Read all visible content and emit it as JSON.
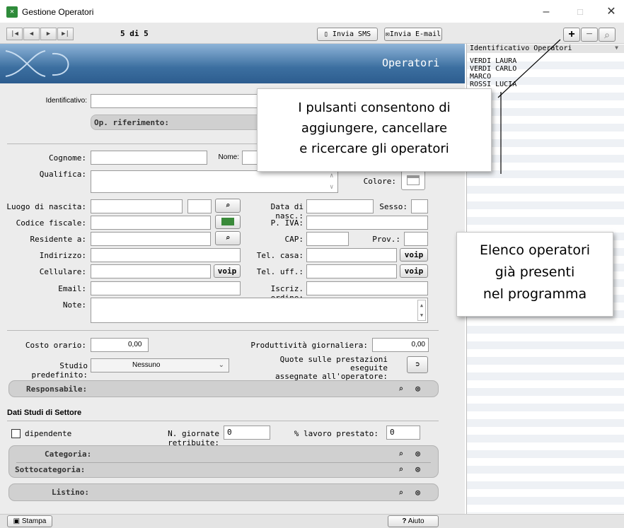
{
  "window": {
    "title": "Gestione Operatori",
    "minimize": "–",
    "maximize": "□",
    "close": "✕"
  },
  "toolbar": {
    "nav": [
      "|◀",
      "◀",
      "▶",
      "▶|"
    ],
    "record_counter": "5 di 5",
    "sms_label": "Invia SMS",
    "email_label": "Invia E-mail",
    "add": "+",
    "remove": "−",
    "search": "⌕"
  },
  "header": {
    "title": "Operatori"
  },
  "form": {
    "identificativo_label": "Identificativo:",
    "identificativo_value": "",
    "op_riferimento_label": "Op. riferimento:",
    "cognome_label": "Cognome:",
    "nome_label": "Nome:",
    "qualifica_label": "Qualifica:",
    "colore_label": "Colore:",
    "luogo_label": "Luogo di nascita:",
    "data_nasc_label": "Data di nasc.:",
    "sesso_label": "Sesso:",
    "codice_fiscale_label": "Codice fiscale:",
    "piva_label": "P. IVA:",
    "residente_label": "Residente a:",
    "cap_label": "CAP:",
    "prov_label": "Prov.:",
    "indirizzo_label": "Indirizzo:",
    "tel_casa_label": "Tel. casa:",
    "cellulare_label": "Cellulare:",
    "tel_uff_label": "Tel. uff.:",
    "email_label": "Email:",
    "iscriz_label": "Iscriz. ordine:",
    "note_label": "Note:",
    "voip": "voip",
    "costo_label": "Costo orario:",
    "costo_value": "0,00",
    "produttivita_label": "Produttività giornaliera:",
    "produttivita_value": "0,00",
    "studio_label": "Studio predefinito:",
    "studio_value": "Nessuno",
    "quote_label_1": "Quote sulle prestazioni eseguite",
    "quote_label_2": "assegnate all'operatore:",
    "responsabile_label": "Responsabile:",
    "dati_studi_label": "Dati Studi di Settore",
    "dipendente_label": "dipendente",
    "giornate_label": "N. giornate retribuite:",
    "giornate_value": "0",
    "lavoro_label": "% lavoro prestato:",
    "lavoro_value": "0",
    "categoria_label": "Categoria:",
    "sottocategoria_label": "Sottocategoria:",
    "listino_label": "Listino:"
  },
  "list": {
    "header": "Identificativo Operatori",
    "items": [
      "VERDI LAURA",
      "VERDI CARLO",
      "MARCO",
      "ROSSI LUCIA"
    ]
  },
  "callouts": {
    "buttons_1": "I pulsanti consentono di",
    "buttons_2": "aggiungere, cancellare",
    "buttons_3": "e ricercare gli operatori",
    "list_1": "Elenco operatori",
    "list_2": "già presenti",
    "list_3": "nel programma"
  },
  "bottom": {
    "stampa": "Stampa",
    "aiuto": "Aiuto",
    "aiuto_icon": "?"
  }
}
